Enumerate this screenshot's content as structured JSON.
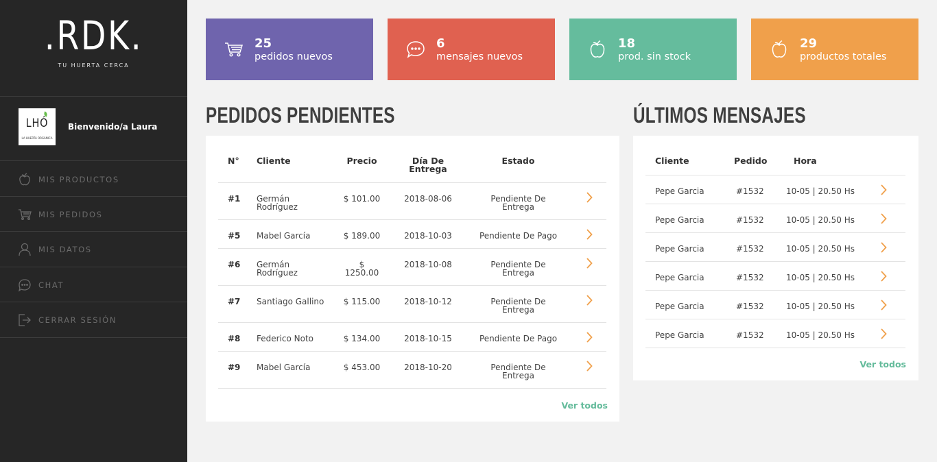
{
  "brand": {
    "logo": ".RDK.",
    "tagline": "TU HUERTA CERCA"
  },
  "user": {
    "avatar_text": "LHÓ",
    "avatar_sub": "LA HUERTA ORGÁNICA",
    "welcome": "Bienvenido/a Laura"
  },
  "sidebar": {
    "items": [
      {
        "label": "MIS PRODUCTOS",
        "icon": "apple-icon"
      },
      {
        "label": "MIS PEDIDOS",
        "icon": "cart-icon"
      },
      {
        "label": "MIS DATOS",
        "icon": "user-icon"
      },
      {
        "label": "CHAT",
        "icon": "chat-icon"
      },
      {
        "label": "CERRAR SESIÓN",
        "icon": "logout-icon"
      }
    ]
  },
  "stats": [
    {
      "number": "25",
      "label": "pedidos nuevos",
      "color": "#6f64ad",
      "icon": "cart-icon"
    },
    {
      "number": "6",
      "label": "mensajes nuevos",
      "color": "#e06150",
      "icon": "chat-icon"
    },
    {
      "number": "18",
      "label": "prod. sin stock",
      "color": "#65bc9d",
      "icon": "apple-icon"
    },
    {
      "number": "29",
      "label": "productos totales",
      "color": "#f0a04b",
      "icon": "apple-icon"
    }
  ],
  "orders": {
    "title": "PEDIDOS PENDIENTES",
    "headers": {
      "num": "N°",
      "client": "Cliente",
      "price": "Precio",
      "date_1": "Día De",
      "date_2": "Entrega",
      "status": "Estado"
    },
    "rows": [
      {
        "num": "#1",
        "client_1": "Germán",
        "client_2": "Rodríguez",
        "price_1": "$ 101.00",
        "price_2": "",
        "date": "2018-08-06",
        "status_1": "Pendiente De",
        "status_2": "Entrega"
      },
      {
        "num": "#5",
        "client_1": "Mabel García",
        "client_2": "",
        "price_1": "$ 189.00",
        "price_2": "",
        "date": "2018-10-03",
        "status_1": "Pendiente De Pago",
        "status_2": ""
      },
      {
        "num": "#6",
        "client_1": "Germán",
        "client_2": "Rodríguez",
        "price_1": "$",
        "price_2": "1250.00",
        "date": "2018-10-08",
        "status_1": "Pendiente De",
        "status_2": "Entrega"
      },
      {
        "num": "#7",
        "client_1": "Santiago Gallino",
        "client_2": "",
        "price_1": "$ 115.00",
        "price_2": "",
        "date": "2018-10-12",
        "status_1": "Pendiente De",
        "status_2": "Entrega"
      },
      {
        "num": "#8",
        "client_1": "Federico Noto",
        "client_2": "",
        "price_1": "$ 134.00",
        "price_2": "",
        "date": "2018-10-15",
        "status_1": "Pendiente De Pago",
        "status_2": ""
      },
      {
        "num": "#9",
        "client_1": "Mabel García",
        "client_2": "",
        "price_1": "$ 453.00",
        "price_2": "",
        "date": "2018-10-20",
        "status_1": "Pendiente De",
        "status_2": "Entrega"
      }
    ],
    "see_all": "Ver todos"
  },
  "messages": {
    "title": "ÚLTIMOS MENSAJES",
    "headers": {
      "client": "Cliente",
      "order": "Pedido",
      "time": "Hora"
    },
    "rows": [
      {
        "client": "Pepe Garcia",
        "order": "#1532",
        "time": "10-05 | 20.50 Hs"
      },
      {
        "client": "Pepe Garcia",
        "order": "#1532",
        "time": "10-05 | 20.50 Hs"
      },
      {
        "client": "Pepe Garcia",
        "order": "#1532",
        "time": "10-05 | 20.50 Hs"
      },
      {
        "client": "Pepe Garcia",
        "order": "#1532",
        "time": "10-05 | 20.50 Hs"
      },
      {
        "client": "Pepe Garcia",
        "order": "#1532",
        "time": "10-05 | 20.50 Hs"
      },
      {
        "client": "Pepe Garcia",
        "order": "#1532",
        "time": "10-05 | 20.50 Hs"
      }
    ],
    "see_all": "Ver todos"
  },
  "colors": {
    "sidebar": "#262626",
    "accent_link": "#64bb9b",
    "chevron": "#f0a04b"
  }
}
